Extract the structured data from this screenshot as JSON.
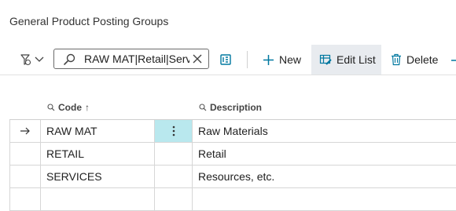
{
  "page": {
    "title": "General Product Posting Groups"
  },
  "toolbar": {
    "search_value": "RAW MAT|Retail|Services",
    "new_label": "New",
    "edit_list_label": "Edit List",
    "delete_label": "Delete",
    "accent_color": "#0078a0"
  },
  "table": {
    "columns": {
      "code": "Code",
      "code_sort": "↑",
      "description": "Description"
    },
    "rows": [
      {
        "code": "RAW MAT",
        "description": "Raw Materials",
        "selected": true
      },
      {
        "code": "RETAIL",
        "description": "Retail"
      },
      {
        "code": "SERVICES",
        "description": "Resources, etc."
      },
      {
        "code": "",
        "description": ""
      }
    ]
  }
}
